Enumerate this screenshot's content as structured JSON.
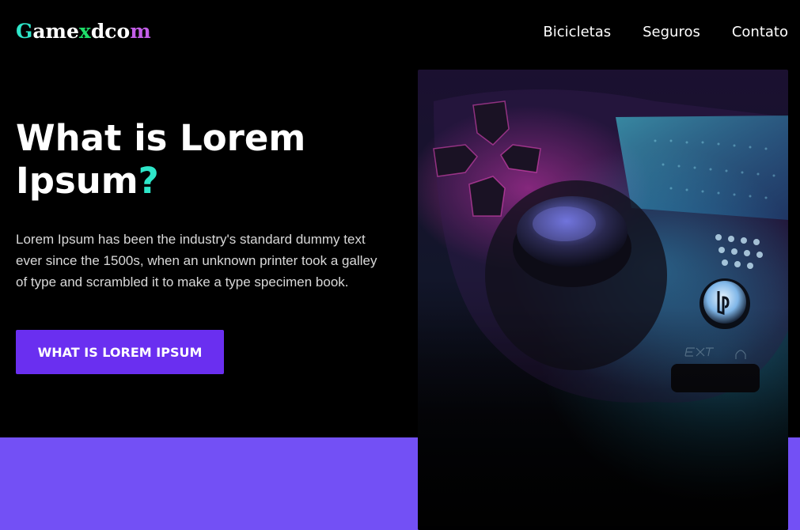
{
  "header": {
    "logo_letters": [
      {
        "char": "G",
        "color": "teal"
      },
      {
        "char": "ame",
        "color": "white"
      },
      {
        "char": "x",
        "color": "green"
      },
      {
        "char": "dco",
        "color": "white"
      },
      {
        "char": "m",
        "color": "pink"
      }
    ],
    "nav": [
      "Bicicletas",
      "Seguros",
      "Contato"
    ]
  },
  "hero": {
    "title_line1": "What is Lorem",
    "title_line2": "Ipsum",
    "title_mark": "?",
    "text": "Lorem Ipsum has been the industry's standard dummy text ever since the 1500s, when an unknown printer took a galley of type and scrambled it to make a type specimen book.",
    "cta_label": "WHAT IS LOREM IPSUM",
    "image_label": "game-controller-photo"
  },
  "colors": {
    "background": "#000000",
    "accent_teal": "#2ee6c9",
    "accent_green": "#1fe06a",
    "accent_pink": "#c35ee8",
    "button": "#6a2ff0",
    "band": "#7350f5"
  }
}
